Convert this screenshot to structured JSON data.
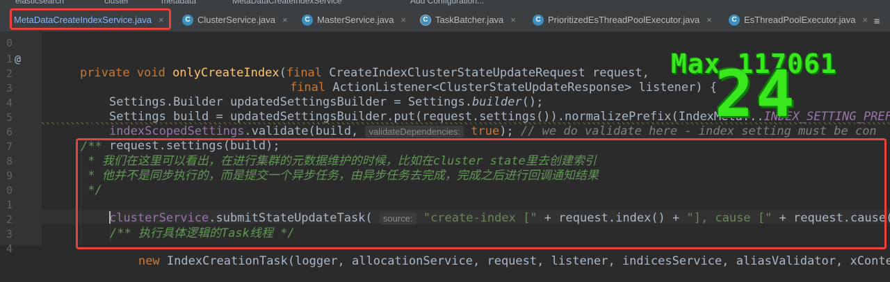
{
  "breadcrumbs": [
    "elasticsearch",
    "cluster",
    "metadata",
    "MetaDataCreateIndexService",
    "Add Configuration..."
  ],
  "tabs": [
    {
      "label": "MetaDataCreateIndexService.java",
      "icon": "class-icon",
      "active": true
    },
    {
      "label": "ClusterService.java",
      "icon": "class-icon"
    },
    {
      "label": "MasterService.java",
      "icon": "class-icon"
    },
    {
      "label": "TaskBatcher.java",
      "icon": "class-icon"
    },
    {
      "label": "PrioritizedEsThreadPoolExecutor.java",
      "icon": "class-icon"
    },
    {
      "label": "EsThreadPoolExecutor.java",
      "icon": "class-icon"
    }
  ],
  "tab_close_glyph": "×",
  "tab_menu_glyph": "≡",
  "gutter": {
    "line_numbers": [
      "0",
      "1",
      "2",
      "3",
      "4",
      "5",
      "6",
      "7",
      "8",
      "9",
      "0",
      "1",
      "2",
      "3",
      "4"
    ],
    "annotation_marker": "@"
  },
  "code": {
    "l1_kw1": "private",
    "l1_kw2": "void",
    "l1_fn": "onlyCreateIndex",
    "l1_open": "(",
    "l1_kw3": "final",
    "l1_type": "CreateIndexClusterStateUpdateRequest request,",
    "l2_kw": "final",
    "l2_type": "ActionListener<ClusterStateUpdateResponse> listener) {",
    "l3_a": "Settings.Builder updatedSettingsBuilder = Settings.",
    "l3_it": "builder",
    "l3_b": "();",
    "l4_a": "Settings build = updatedSettingsBuilder.put(request.settings()).normalizePrefix(IndexMeta",
    "l4_b": "...",
    "l4_c": "INDEX_SETTING_PREF",
    "l5_fld": "indexScopedSettings",
    "l5_a": ".validate(build,",
    "l5_hint": "validateDependencies:",
    "l5_kw": "true",
    "l5_b": ");",
    "l5_cmt": "// we do validate here - index setting must be con",
    "l6": "request.settings(build);",
    "l7": "/**",
    "l8": " * 我们在这里可以看出，在进行集群的元数据维护的时候，比如在cluster state里去创建索引",
    "l9": " * 他并不是同步执行的，而是提交一个异步任务，由异步任务去完成，完成之后进行回调通知结果",
    "l10": " */",
    "l11_fld": "clusterService",
    "l11_a": ".submitStateUpdateTask(",
    "l11_hint": "source:",
    "l11_str1": "\"create-index [\"",
    "l11_b": " + request.index() + ",
    "l11_str2": "\"], cause [\"",
    "l11_c": " + request.cause()",
    "l13": "/** 执行具体逻辑的Task线程 */",
    "l14_kw": "new",
    "l14_a": " IndexCreationTask(logger, allocationService, request, listener, indicesService, aliasValidator, xConte"
  },
  "overlay": {
    "max_label": "Max 117061",
    "counter": "24"
  },
  "colors": {
    "highlight_box": "#e8423f",
    "overlay_green": "#39e81c",
    "background": "#2b2b2b"
  }
}
